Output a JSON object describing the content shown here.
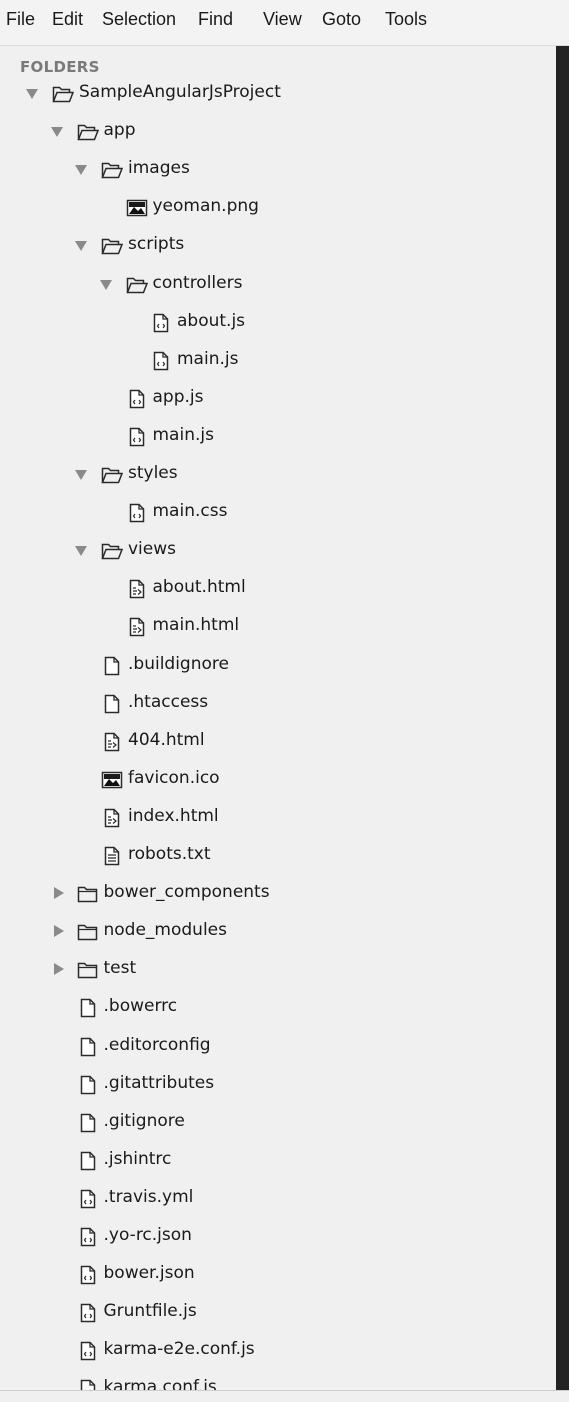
{
  "menu": {
    "items": [
      "File",
      "Edit",
      "Selection",
      "Find",
      "View",
      "Goto",
      "Tools"
    ]
  },
  "sidebar": {
    "header": "FOLDERS",
    "tree": [
      {
        "name": "SampleAngularJsProject",
        "kind": "folder",
        "depth": 0,
        "expanded": true
      },
      {
        "name": "app",
        "kind": "folder",
        "depth": 1,
        "expanded": true
      },
      {
        "name": "images",
        "kind": "folder",
        "depth": 2,
        "expanded": true
      },
      {
        "name": "yeoman.png",
        "kind": "image",
        "depth": 3
      },
      {
        "name": "scripts",
        "kind": "folder",
        "depth": 2,
        "expanded": true
      },
      {
        "name": "controllers",
        "kind": "folder",
        "depth": 3,
        "expanded": true
      },
      {
        "name": "about.js",
        "kind": "code",
        "depth": 4
      },
      {
        "name": "main.js",
        "kind": "code",
        "depth": 4
      },
      {
        "name": "app.js",
        "kind": "code",
        "depth": 3
      },
      {
        "name": "main.js",
        "kind": "code",
        "depth": 3
      },
      {
        "name": "styles",
        "kind": "folder",
        "depth": 2,
        "expanded": true
      },
      {
        "name": "main.css",
        "kind": "code",
        "depth": 3
      },
      {
        "name": "views",
        "kind": "folder",
        "depth": 2,
        "expanded": true
      },
      {
        "name": "about.html",
        "kind": "markup",
        "depth": 3
      },
      {
        "name": "main.html",
        "kind": "markup",
        "depth": 3
      },
      {
        "name": ".buildignore",
        "kind": "file",
        "depth": 2
      },
      {
        "name": ".htaccess",
        "kind": "file",
        "depth": 2
      },
      {
        "name": "404.html",
        "kind": "markup",
        "depth": 2
      },
      {
        "name": "favicon.ico",
        "kind": "image",
        "depth": 2
      },
      {
        "name": "index.html",
        "kind": "markup",
        "depth": 2
      },
      {
        "name": "robots.txt",
        "kind": "text",
        "depth": 2
      },
      {
        "name": "bower_components",
        "kind": "folder",
        "depth": 1,
        "expanded": false
      },
      {
        "name": "node_modules",
        "kind": "folder",
        "depth": 1,
        "expanded": false
      },
      {
        "name": "test",
        "kind": "folder",
        "depth": 1,
        "expanded": false
      },
      {
        "name": ".bowerrc",
        "kind": "file",
        "depth": 1
      },
      {
        "name": ".editorconfig",
        "kind": "file",
        "depth": 1
      },
      {
        "name": ".gitattributes",
        "kind": "file",
        "depth": 1
      },
      {
        "name": ".gitignore",
        "kind": "file",
        "depth": 1
      },
      {
        "name": ".jshintrc",
        "kind": "file",
        "depth": 1
      },
      {
        "name": ".travis.yml",
        "kind": "code",
        "depth": 1
      },
      {
        "name": ".yo-rc.json",
        "kind": "code",
        "depth": 1
      },
      {
        "name": "bower.json",
        "kind": "code",
        "depth": 1
      },
      {
        "name": "Gruntfile.js",
        "kind": "code",
        "depth": 1
      },
      {
        "name": "karma-e2e.conf.js",
        "kind": "code",
        "depth": 1
      },
      {
        "name": "karma.conf.js",
        "kind": "code",
        "depth": 1
      }
    ]
  },
  "colors": {
    "menubar_bg": "#f3f3f3",
    "sidebar_bg": "#f0f0f0",
    "editor_edge": "#232323",
    "header_text": "#7a7a7a",
    "arrow": "#8a8a8a"
  },
  "icons": {
    "folder_open": "folder-open-icon",
    "folder_closed": "folder-icon",
    "image": "image-file-icon",
    "code": "code-file-icon",
    "markup": "markup-file-icon",
    "text": "text-file-icon",
    "file": "file-icon"
  }
}
